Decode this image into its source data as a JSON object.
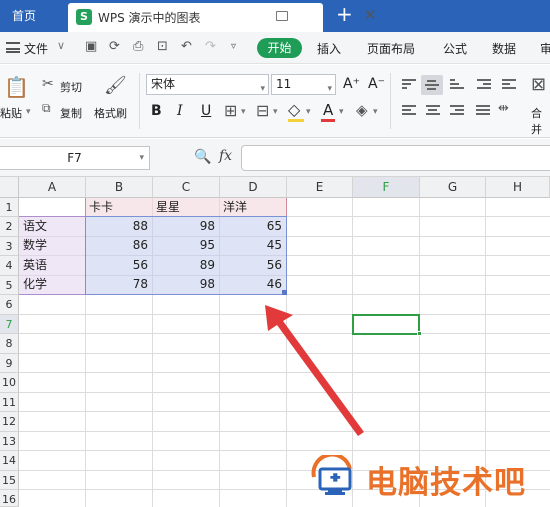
{
  "tabs": {
    "home": "首页",
    "doc_title": "WPS 演示中的图表",
    "doc_logo": "S",
    "add": "+",
    "close": "✕"
  },
  "menu": {
    "file": "文件",
    "file_arrow": "∨",
    "start": "开始",
    "insert": "插入",
    "layout": "页面布局",
    "formula": "公式",
    "data": "数据",
    "review_partial": "审"
  },
  "ribbon": {
    "paste": "粘贴",
    "cut": "剪切",
    "copy": "复制",
    "format_painter": "格式刷",
    "font_name": "宋体",
    "font_size": "11",
    "bold": "B",
    "italic": "I",
    "underline": "U",
    "font_color": "A",
    "grow": "A⁺",
    "shrink": "A⁻",
    "merge_partial": "合并"
  },
  "formula_bar": {
    "cell_ref": "F7",
    "fx": "fx",
    "value": ""
  },
  "grid": {
    "columns": [
      "A",
      "B",
      "C",
      "D",
      "E",
      "F",
      "G",
      "H"
    ],
    "rows": [
      "1",
      "2",
      "3",
      "4",
      "5",
      "6",
      "7",
      "8",
      "9",
      "10",
      "11",
      "12",
      "13",
      "14",
      "15",
      "16"
    ],
    "headers": [
      "卡卡",
      "星星",
      "洋洋"
    ],
    "data": [
      {
        "subject": "语文",
        "values": [
          "88",
          "98",
          "65"
        ]
      },
      {
        "subject": "数学",
        "values": [
          "86",
          "95",
          "45"
        ]
      },
      {
        "subject": "英语",
        "values": [
          "56",
          "89",
          "56"
        ]
      },
      {
        "subject": "化学",
        "values": [
          "78",
          "98",
          "46"
        ]
      }
    ],
    "active_cell": "F7"
  },
  "watermark": {
    "text": "电脑技术吧",
    "color": "#e9712a"
  },
  "colors": {
    "tab_bar": "#2a63b8",
    "start_button": "#1f9d56",
    "active_cell": "#2f9e44",
    "arrow": "#e23a3a"
  }
}
